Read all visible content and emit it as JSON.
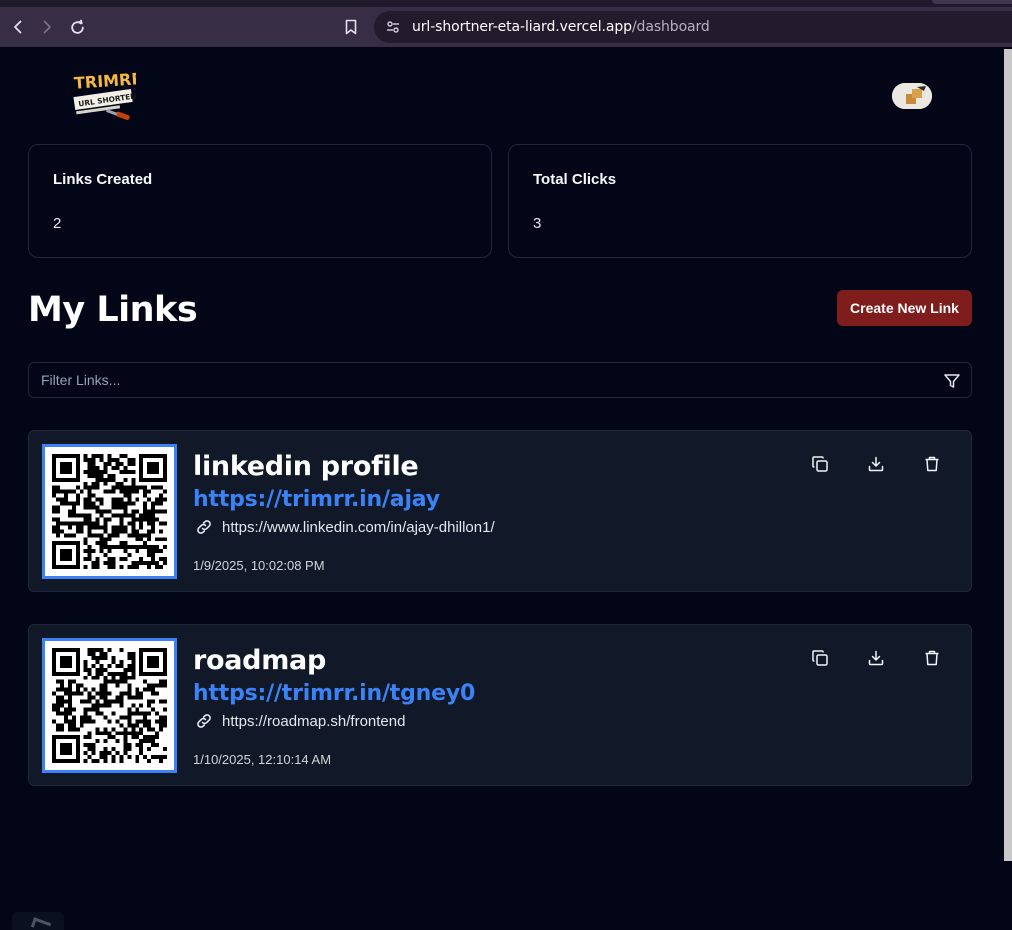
{
  "browser": {
    "url_host": "url-shortner-eta-liard.vercel.app",
    "url_path": "/dashboard",
    "back_icon": "chevron-left-icon",
    "forward_icon": "chevron-right-icon",
    "reload_icon": "reload-icon",
    "bookmark_icon": "bookmark-icon",
    "site_info_icon": "tune-icon"
  },
  "header": {
    "logo_top": "TRIMRR",
    "logo_bottom": "URL SHORTENER"
  },
  "stats": [
    {
      "title": "Links Created",
      "value": "2"
    },
    {
      "title": "Total Clicks",
      "value": "3"
    }
  ],
  "links_section": {
    "title": "My Links",
    "create_button": "Create New Link",
    "filter_placeholder": "Filter Links...",
    "filter_icon": "filter-icon"
  },
  "links": [
    {
      "title": "linkedin profile",
      "short_url": "https://trimrr.in/ajay",
      "original_url": "https://www.linkedin.com/in/ajay-dhillon1/",
      "created_at": "1/9/2025, 10:02:08 PM"
    },
    {
      "title": "roadmap",
      "short_url": "https://trimrr.in/tgney0",
      "original_url": "https://roadmap.sh/frontend",
      "created_at": "1/10/2025, 12:10:14 AM"
    }
  ],
  "colors": {
    "background": "#020617",
    "card": "#111827",
    "accent_blue": "#3b82f6",
    "create_button": "#7f1d1d"
  }
}
